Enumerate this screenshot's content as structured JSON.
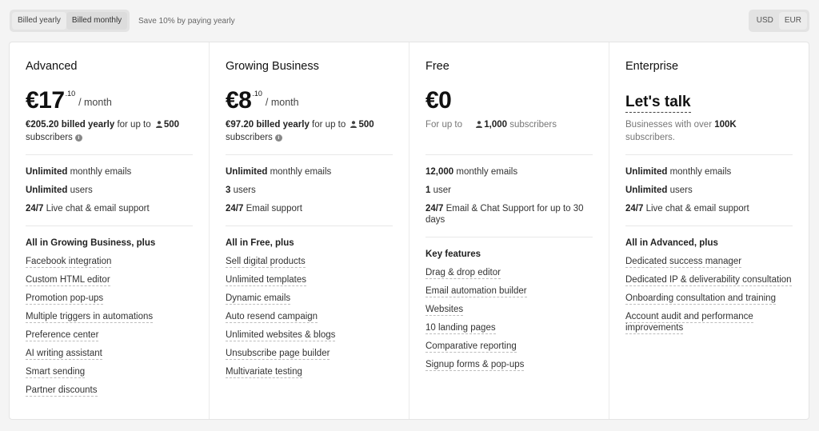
{
  "billing_toggle": {
    "yearly": "Billed yearly",
    "monthly": "Billed monthly"
  },
  "save_note": "Save 10% by paying yearly",
  "currency": {
    "usd": "USD",
    "eur": "EUR"
  },
  "plans": [
    {
      "name": "Advanced",
      "price": "€17",
      "cents": ".10",
      "unit": "/ month",
      "billed_amount": "€205.20 billed yearly",
      "billed_for": " for up to ",
      "subs_count": "500",
      "subs_word": "subscribers",
      "limits": [
        {
          "bold": "Unlimited",
          "text": " monthly emails"
        },
        {
          "bold": "Unlimited",
          "text": " users"
        },
        {
          "bold": "24/7",
          "text": " Live chat & email support"
        }
      ],
      "features_head": "All in Growing Business, plus",
      "features": [
        "Facebook integration",
        "Custom HTML editor",
        "Promotion pop-ups",
        "Multiple triggers in automations",
        "Preference center",
        "AI writing assistant",
        "Smart sending",
        "Partner discounts"
      ]
    },
    {
      "name": "Growing Business",
      "price": "€8",
      "cents": ".10",
      "unit": "/ month",
      "billed_amount": "€97.20 billed yearly",
      "billed_for": " for up to ",
      "subs_count": "500",
      "subs_word": "subscribers",
      "limits": [
        {
          "bold": "Unlimited",
          "text": " monthly emails"
        },
        {
          "bold": "3",
          "text": " users"
        },
        {
          "bold": "24/7",
          "text": " Email support"
        }
      ],
      "features_head": "All in Free, plus",
      "features": [
        "Sell digital products",
        "Unlimited templates",
        "Dynamic emails",
        "Auto resend campaign",
        "Unlimited websites & blogs",
        "Unsubscribe page builder",
        "Multivariate testing"
      ]
    },
    {
      "name": "Free",
      "price": "€0",
      "free_prefix": "For up to",
      "subs_count": "1,000",
      "subs_word": "subscribers",
      "limits": [
        {
          "bold": "12,000",
          "text": " monthly emails"
        },
        {
          "bold": "1",
          "text": " user"
        },
        {
          "bold": "24/7",
          "text": " Email & Chat Support for up to 30 days"
        }
      ],
      "features_head": "Key features",
      "features": [
        "Drag & drop editor",
        "Email automation builder",
        "Websites",
        "10 landing pages",
        "Comparative reporting",
        "Signup forms & pop-ups"
      ]
    },
    {
      "name": "Enterprise",
      "price_text": "Let's talk",
      "ent_prefix": "Businesses with over ",
      "ent_bold": "100K",
      "ent_suffix": " subscribers.",
      "limits": [
        {
          "bold": "Unlimited",
          "text": " monthly emails"
        },
        {
          "bold": "Unlimited",
          "text": " users"
        },
        {
          "bold": "24/7",
          "text": " Live chat & email support"
        }
      ],
      "features_head": "All in Advanced, plus",
      "features": [
        "Dedicated success manager",
        "Dedicated IP & deliverability consultation",
        "Onboarding consultation and training",
        "Account audit and performance improvements"
      ]
    }
  ]
}
